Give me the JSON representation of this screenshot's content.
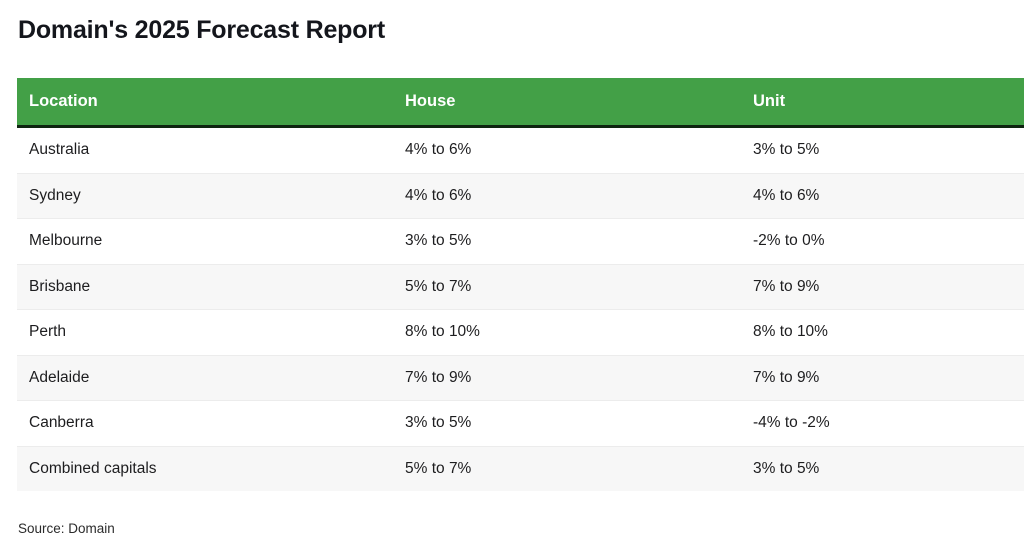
{
  "title": "Domain's 2025 Forecast Report",
  "source_note": "Source: Domain",
  "colors": {
    "header_background": "#43a047",
    "header_text": "#ffffff",
    "header_rule": "#0e2410",
    "row_alt_background": "#f7f7f7",
    "row_background": "#ffffff",
    "row_divider": "#ececec",
    "title_text": "#14161c",
    "body_text": "#1d1d1f"
  },
  "table": {
    "columns": [
      {
        "key": "location",
        "label": "Location"
      },
      {
        "key": "house",
        "label": "House"
      },
      {
        "key": "unit",
        "label": "Unit"
      }
    ],
    "rows": [
      {
        "location": "Australia",
        "house": "4% to 6%",
        "unit": "3% to 5%"
      },
      {
        "location": "Sydney",
        "house": "4% to 6%",
        "unit": "4% to 6%"
      },
      {
        "location": "Melbourne",
        "house": "3% to 5%",
        "unit": "-2% to 0%"
      },
      {
        "location": "Brisbane",
        "house": "5% to 7%",
        "unit": "7% to 9%"
      },
      {
        "location": "Perth",
        "house": "8% to 10%",
        "unit": "8% to 10%"
      },
      {
        "location": "Adelaide",
        "house": "7% to 9%",
        "unit": "7% to 9%"
      },
      {
        "location": "Canberra",
        "house": "3% to 5%",
        "unit": "-4% to -2%"
      },
      {
        "location": "Combined capitals",
        "house": "5% to 7%",
        "unit": "3% to 5%"
      }
    ]
  },
  "chart_data": {
    "type": "table",
    "title": "Domain's 2025 Forecast Report",
    "columns": [
      "Location",
      "House",
      "Unit"
    ],
    "categories": [
      "Australia",
      "Sydney",
      "Melbourne",
      "Brisbane",
      "Perth",
      "Adelaide",
      "Canberra",
      "Combined capitals"
    ],
    "series": [
      {
        "name": "House",
        "values": [
          "4% to 6%",
          "4% to 6%",
          "3% to 5%",
          "5% to 7%",
          "8% to 10%",
          "7% to 9%",
          "3% to 5%",
          "5% to 7%"
        ],
        "low": [
          4,
          4,
          3,
          5,
          8,
          7,
          3,
          5
        ],
        "high": [
          6,
          6,
          5,
          7,
          10,
          9,
          5,
          7
        ]
      },
      {
        "name": "Unit",
        "values": [
          "3% to 5%",
          "4% to 6%",
          "-2% to 0%",
          "7% to 9%",
          "8% to 10%",
          "7% to 9%",
          "-4% to -2%",
          "3% to 5%"
        ],
        "low": [
          3,
          4,
          -2,
          7,
          8,
          7,
          -4,
          3
        ],
        "high": [
          5,
          6,
          0,
          9,
          10,
          9,
          -2,
          5
        ]
      }
    ],
    "annotations": [
      "Source: Domain"
    ],
    "units": "percent"
  }
}
